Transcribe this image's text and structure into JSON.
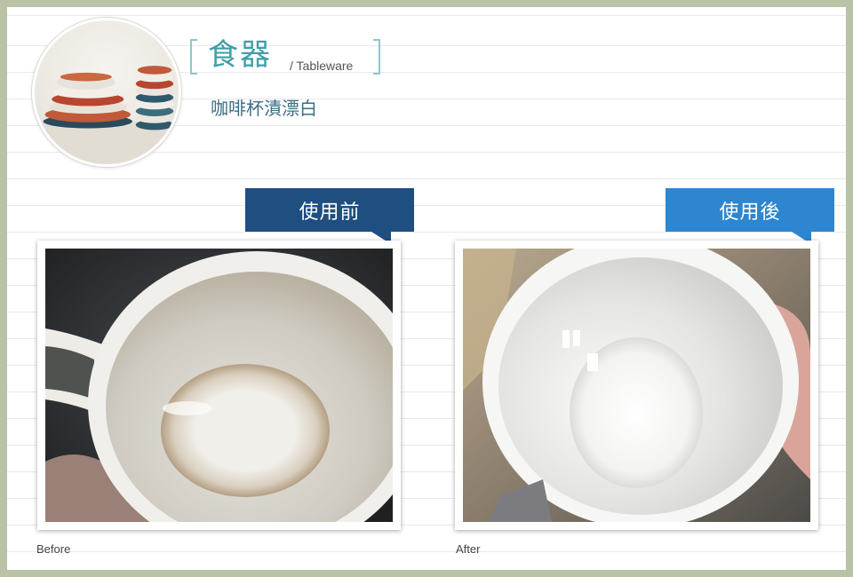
{
  "header": {
    "category_title": "食器",
    "category_en": "/ Tableware",
    "subtitle": "咖啡杯漬漂白"
  },
  "comparison": {
    "before": {
      "tab_label": "使用前",
      "caption": "Before",
      "tab_color": "#1f4e80"
    },
    "after": {
      "tab_label": "使用後",
      "caption": "After",
      "tab_color": "#2d86cf"
    }
  },
  "colors": {
    "frame_background": "#b9c2a6",
    "title_accent": "#3f9fa8",
    "subtitle_text": "#3a6e86"
  }
}
